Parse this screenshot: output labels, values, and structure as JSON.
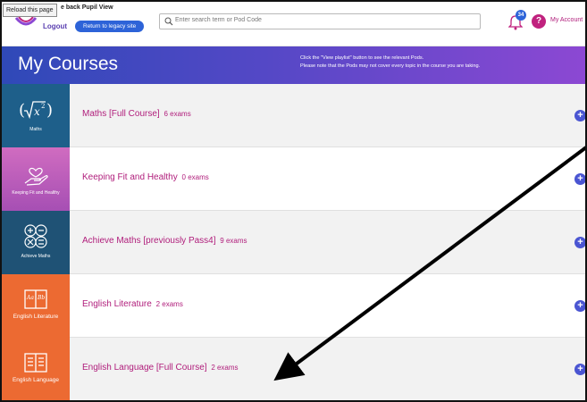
{
  "window": {
    "tooltip": "Reload this page"
  },
  "header": {
    "welcome": "e back Pupil View",
    "logout_label": "Logout",
    "legacy_button": "Return to legacy site",
    "search_placeholder": "Enter search term or Pod Code",
    "notification_count": "34",
    "help_label": "?",
    "account_label": "My Account"
  },
  "banner": {
    "title": "My Courses",
    "note_line1": "Click the \"View playlist\" button to see the relevant Pods.",
    "note_line2": "Please note that the Pods may not cover every topic in the course you are taking."
  },
  "courses": [
    {
      "name": "Maths [Full Course]",
      "count": "6 exams",
      "tile_label": "Maths",
      "tile_color": "#1e5f8a",
      "icon": "square-root-icon"
    },
    {
      "name": "Keeping Fit and Healthy",
      "count": "0 exams",
      "tile_label": "Keeping Fit and Healthy",
      "tile_color": "#c25bb5",
      "icon": "heart-hand-icon"
    },
    {
      "name": "Achieve Maths [previously Pass4]",
      "count": "9 exams",
      "tile_label": "Achieve Maths",
      "tile_color": "#1f5275",
      "icon": "math-operators-icon"
    },
    {
      "name": "English Literature",
      "count": "2 exams",
      "tile_label": "English Literature",
      "tile_color": "#ec6a32",
      "icon": "open-book-icon"
    },
    {
      "name": "English Language [Full Course]",
      "count": "2 exams",
      "tile_label": "English Language",
      "tile_color": "#ec6a32",
      "icon": "text-book-icon"
    }
  ],
  "colors": {
    "accent": "#b01d7b",
    "brand_blue": "#2d63d8",
    "expand_blue": "#4a55d2"
  }
}
